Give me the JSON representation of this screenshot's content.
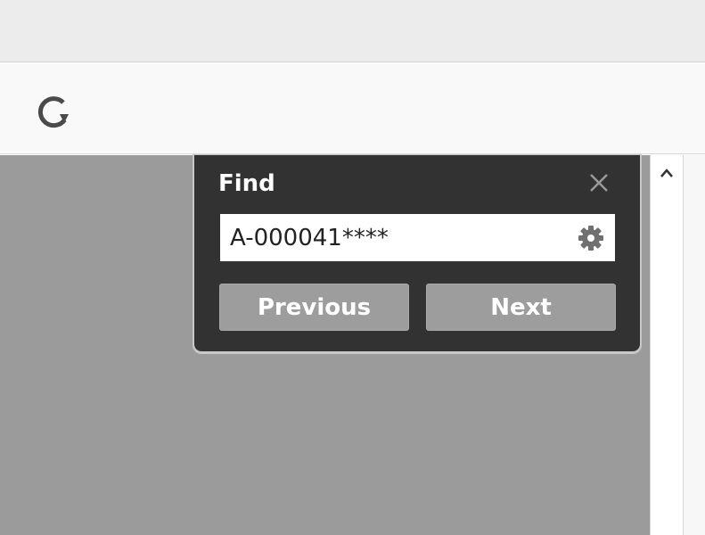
{
  "toolbar": {
    "refresh_icon": "refresh-icon"
  },
  "find_panel": {
    "title": "Find",
    "close_icon": "close-icon",
    "search": {
      "value": "A-000041****",
      "placeholder": ""
    },
    "options_icon": "gear-icon",
    "previous_label": "Previous",
    "next_label": "Next"
  },
  "scrollbar": {
    "up_icon": "chevron-up-icon"
  },
  "colors": {
    "panel_background": "#323232",
    "content_background": "#9b9b9b",
    "button_background": "#9d9d9d"
  }
}
